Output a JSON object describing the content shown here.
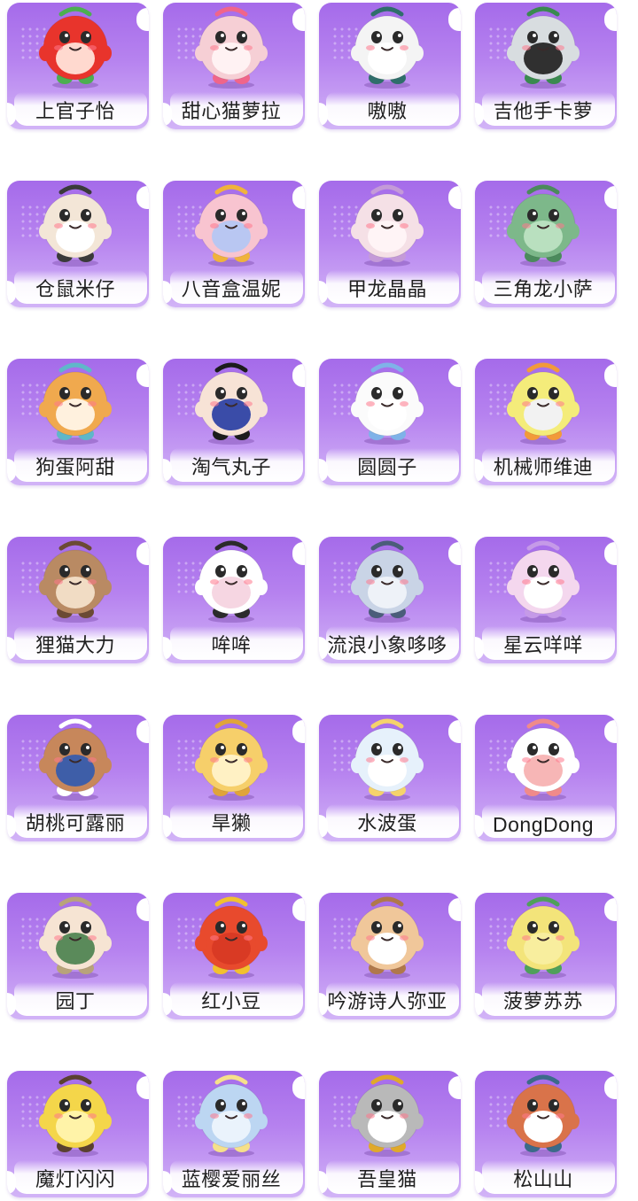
{
  "accent": "#a56bea",
  "characters": [
    {
      "name": "上官子怡",
      "icon": "red-blob-character-icon",
      "body": "#e8342c",
      "belly": "#ffd9cf",
      "accent": "#4caf50"
    },
    {
      "name": "甜心猫萝拉",
      "icon": "pink-cat-character-icon",
      "body": "#f6cfd5",
      "belly": "#fff2f3",
      "accent": "#f0658a"
    },
    {
      "name": "嗷嗷",
      "icon": "panda-character-icon",
      "body": "#f4f4f4",
      "belly": "#ffffff",
      "accent": "#2f6e6a"
    },
    {
      "name": "吉他手卡萝",
      "icon": "guitarist-character-icon",
      "body": "#d8dde0",
      "belly": "#303030",
      "accent": "#3a8a4f"
    },
    {
      "name": "仓鼠米仔",
      "icon": "hamster-character-icon",
      "body": "#f3e6d7",
      "belly": "#ffffff",
      "accent": "#3a3a3a"
    },
    {
      "name": "八音盒温妮",
      "icon": "music-box-character-icon",
      "body": "#f8c4d0",
      "belly": "#b9c7f2",
      "accent": "#f0b33b"
    },
    {
      "name": "甲龙晶晶",
      "icon": "ankylosaur-character-icon",
      "body": "#f5e0e6",
      "belly": "#fff4f6",
      "accent": "#c49ad8"
    },
    {
      "name": "三角龙小萨",
      "icon": "triceratops-character-icon",
      "body": "#7db88a",
      "belly": "#b9e0bf",
      "accent": "#4b8a5c"
    },
    {
      "name": "狗蛋阿甜",
      "icon": "shiba-character-icon",
      "body": "#f0a94e",
      "belly": "#fff1de",
      "accent": "#5fb7c9"
    },
    {
      "name": "淘气丸子",
      "icon": "mischievous-girl-character-icon",
      "body": "#f7e3d6",
      "belly": "#3a4ca8",
      "accent": "#1c1c1c"
    },
    {
      "name": "圆圆子",
      "icon": "white-ghost-character-icon",
      "body": "#fbfbfb",
      "belly": "#ffffff",
      "accent": "#7fb2e8"
    },
    {
      "name": "机械师维迪",
      "icon": "duck-mechanic-character-icon",
      "body": "#f4ec7a",
      "belly": "#f2f2f2",
      "accent": "#f29a3a"
    },
    {
      "name": "狸猫大力",
      "icon": "raccoon-dog-character-icon",
      "body": "#b98a63",
      "belly": "#f1dcc4",
      "accent": "#6b4a34"
    },
    {
      "name": "哞哞",
      "icon": "cow-character-icon",
      "body": "#ffffff",
      "belly": "#f6d6e2",
      "accent": "#2b2b2b"
    },
    {
      "name": "流浪小象哆哆",
      "icon": "elephant-character-icon",
      "body": "#c9d4e6",
      "belly": "#eef2f8",
      "accent": "#4b5d7a"
    },
    {
      "name": "星云咩咩",
      "icon": "nebula-sheep-character-icon",
      "body": "#f4d7ee",
      "belly": "#ffffff",
      "accent": "#c59ae8"
    },
    {
      "name": "胡桃可露丽",
      "icon": "walnut-chef-character-icon",
      "body": "#c7875b",
      "belly": "#3e5ea8",
      "accent": "#ffffff"
    },
    {
      "name": "旱獭",
      "icon": "marmot-character-icon",
      "body": "#f6cf6a",
      "belly": "#fff1c4",
      "accent": "#e0a43a"
    },
    {
      "name": "水波蛋",
      "icon": "poached-egg-character-icon",
      "body": "#e6f1fb",
      "belly": "#ffffff",
      "accent": "#f5d36b"
    },
    {
      "name": "DongDong",
      "icon": "white-sheep-character-icon",
      "body": "#ffffff",
      "belly": "#f7b6b6",
      "accent": "#f08a8a"
    },
    {
      "name": "园丁",
      "icon": "gardener-character-icon",
      "body": "#f6e4d3",
      "belly": "#5a8a5a",
      "accent": "#b8a37a"
    },
    {
      "name": "红小豆",
      "icon": "red-bean-character-icon",
      "body": "#e84a2d",
      "belly": "#d93a24",
      "accent": "#f2c12e"
    },
    {
      "name": "吟游诗人弥亚",
      "icon": "bard-deer-character-icon",
      "body": "#f0c79a",
      "belly": "#ffffff",
      "accent": "#b0784a"
    },
    {
      "name": "菠萝苏苏",
      "icon": "pineapple-character-icon",
      "body": "#f3e47a",
      "belly": "#f8ee9e",
      "accent": "#4fa05a"
    },
    {
      "name": "魔灯闪闪",
      "icon": "magic-lamp-character-icon",
      "body": "#f4d64a",
      "belly": "#fff3a8",
      "accent": "#5a4030"
    },
    {
      "name": "蓝樱爱丽丝",
      "icon": "blue-alice-character-icon",
      "body": "#bcd6f2",
      "belly": "#eaf3fc",
      "accent": "#f6e08a"
    },
    {
      "name": "吾皇猫",
      "icon": "emperor-cat-character-icon",
      "body": "#b9b9b9",
      "belly": "#ffffff",
      "accent": "#e0a92a"
    },
    {
      "name": "松山山",
      "icon": "red-panda-character-icon",
      "body": "#d9734a",
      "belly": "#ffffff",
      "accent": "#3c6a8a"
    }
  ]
}
